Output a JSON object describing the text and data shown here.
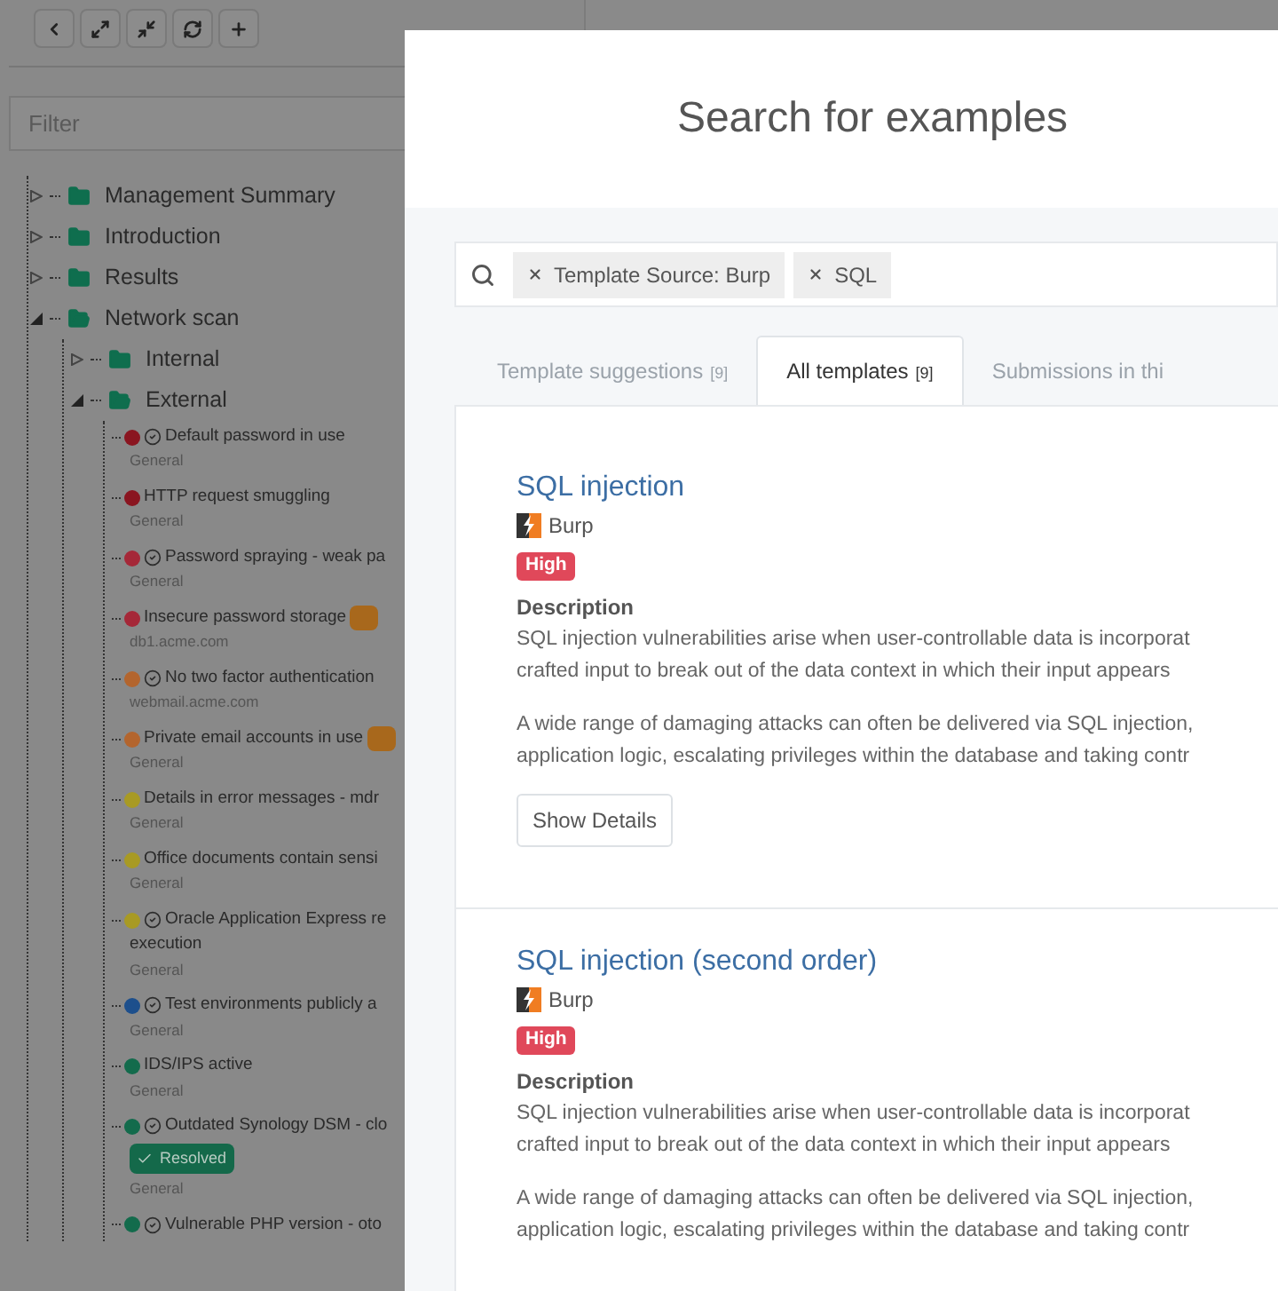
{
  "toolbar": {
    "buttons": [
      {
        "kind": "back"
      },
      {
        "kind": "expand"
      },
      {
        "kind": "collapse"
      },
      {
        "kind": "refresh"
      },
      {
        "kind": "add"
      }
    ]
  },
  "filter": {
    "placeholder": "Filter"
  },
  "tree": [
    {
      "kind": "folder",
      "label": "Management Summary",
      "expanded": false
    },
    {
      "kind": "folder",
      "label": "Introduction",
      "expanded": false
    },
    {
      "kind": "folder",
      "label": "Results",
      "expanded": false
    },
    {
      "kind": "folder",
      "label": "Network scan",
      "expanded": true,
      "children": [
        {
          "kind": "folder",
          "label": "Internal",
          "expanded": false
        },
        {
          "kind": "folder",
          "label": "External",
          "expanded": true,
          "children": [
            {
              "kind": "finding",
              "label": "Default password in use",
              "color": "#8a1520",
              "verified": true,
              "tagged": false,
              "resolved": false,
              "subtitle": "General"
            },
            {
              "kind": "finding",
              "label": "HTTP request smuggling",
              "color": "#8a1520",
              "verified": false,
              "tagged": false,
              "resolved": false,
              "subtitle": "General"
            },
            {
              "kind": "finding",
              "label": "Password spraying - weak pa",
              "color": "#a52838",
              "verified": true,
              "tagged": false,
              "resolved": false,
              "subtitle": "General"
            },
            {
              "kind": "finding",
              "label": "Insecure password storage",
              "color": "#a52838",
              "verified": false,
              "tagged": true,
              "resolved": false,
              "subtitle": "db1.acme.com"
            },
            {
              "kind": "finding",
              "label": "No two factor authentication",
              "color": "#b3652e",
              "verified": true,
              "tagged": false,
              "resolved": false,
              "subtitle": "webmail.acme.com"
            },
            {
              "kind": "finding",
              "label": "Private email accounts in use",
              "color": "#b3652e",
              "verified": false,
              "tagged": true,
              "resolved": false,
              "subtitle": "General"
            },
            {
              "kind": "finding",
              "label": "Details in error messages - mdr",
              "color": "#a89a24",
              "verified": false,
              "tagged": false,
              "resolved": false,
              "subtitle": "General"
            },
            {
              "kind": "finding",
              "label": "Office documents contain sensi",
              "color": "#a89a24",
              "verified": false,
              "tagged": false,
              "resolved": false,
              "subtitle": "General"
            },
            {
              "kind": "finding",
              "label": "Oracle Application Express re",
              "label_cont": "execution",
              "color": "#a89a24",
              "verified": true,
              "tagged": false,
              "resolved": false,
              "subtitle": "General"
            },
            {
              "kind": "finding",
              "label": "Test environments publicly a",
              "color": "#1d4f8c",
              "verified": true,
              "tagged": false,
              "resolved": false,
              "subtitle": "General"
            },
            {
              "kind": "finding",
              "label": "IDS/IPS active",
              "color": "#136b4c",
              "verified": false,
              "tagged": false,
              "resolved": false,
              "subtitle": "General"
            },
            {
              "kind": "finding",
              "label": "Outdated Synology DSM - clo",
              "color": "#136b4c",
              "verified": true,
              "tagged": false,
              "resolved": true,
              "resolved_label": "Resolved",
              "subtitle": "General"
            },
            {
              "kind": "finding",
              "label": "Vulnerable PHP version - oto",
              "color": "#136b4c",
              "verified": true,
              "tagged": false,
              "resolved": false
            }
          ]
        }
      ]
    }
  ],
  "modal": {
    "title": "Search for examples",
    "search_tags": [
      {
        "label": "Template Source: Burp"
      },
      {
        "label": "SQL"
      }
    ],
    "tabs": [
      {
        "label": "Template suggestions",
        "count": "[9]",
        "selected": false
      },
      {
        "label": "All templates",
        "count": "[9]",
        "selected": true
      },
      {
        "label": "Submissions in thi",
        "selected": false
      }
    ],
    "templates": [
      {
        "title": "SQL injection",
        "source": "Burp",
        "severity": "High",
        "description_label": "Description",
        "paragraphs": [
          [
            "SQL injection vulnerabilities arise when user-controllable data is incorporat",
            "crafted input to break out of the data context in which their input appears"
          ],
          [
            "A wide range of damaging attacks can often be delivered via SQL injection,",
            "application logic, escalating privileges within the database and taking contr"
          ]
        ],
        "button": "Show Details"
      },
      {
        "title": "SQL injection (second order)",
        "source": "Burp",
        "severity": "High",
        "description_label": "Description",
        "paragraphs": [
          [
            "SQL injection vulnerabilities arise when user-controllable data is incorporat",
            "crafted input to break out of the data context in which their input appears"
          ],
          [
            "A wide range of damaging attacks can often be delivered via SQL injection,",
            "application logic, escalating privileges within the database and taking contr"
          ]
        ]
      }
    ]
  }
}
